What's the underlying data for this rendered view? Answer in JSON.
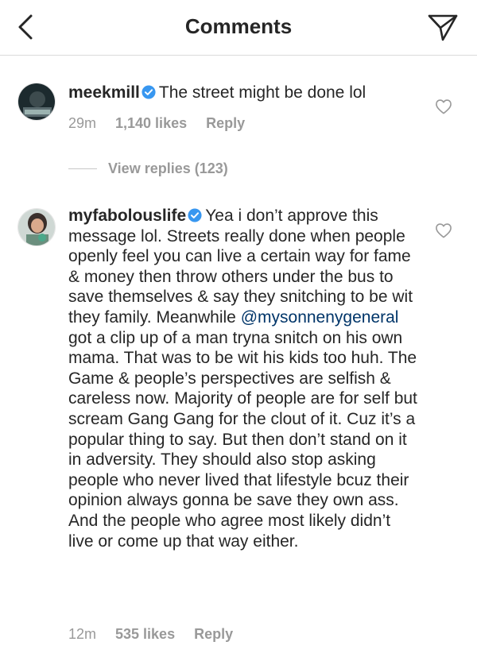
{
  "header": {
    "title": "Comments",
    "back_icon": "chevron-left-icon",
    "share_icon": "paper-plane-icon"
  },
  "comments": [
    {
      "username": "meekmill",
      "verified": true,
      "text": "The street might be done lol",
      "time": "29m",
      "likes": "1,140 likes",
      "reply": "Reply",
      "view_replies": "View replies (123)"
    },
    {
      "username": "myfabolouslife",
      "verified": true,
      "text_before_mention": "Yea i don’t approve this message lol. Streets really done when people openly feel you can live a certain way for fame & money then throw others under the bus to save themselves & say they snitching to be wit they family.  Meanwhile ",
      "mention": "@mysonnenygeneral",
      "text_after_mention": " got a clip up of a man tryna snitch on his own mama. That was to be wit his kids too huh. The Game & people’s perspectives are selfish & careless now. Majority of people are for self but scream Gang Gang for the clout of it. Cuz it’s a popular thing to say. But then don’t stand on it in adversity.  They should also stop asking people who never lived that lifestyle bcuz their opinion always gonna be save they own ass. And the people who agree most likely didn’t live or come up that way either.",
      "time": "12m",
      "likes": "535 likes",
      "reply": "Reply"
    }
  ],
  "colors": {
    "text": "#262626",
    "meta": "#999999",
    "mention": "#003569",
    "verified": "#3897f0",
    "divider": "#dbdbdb"
  }
}
